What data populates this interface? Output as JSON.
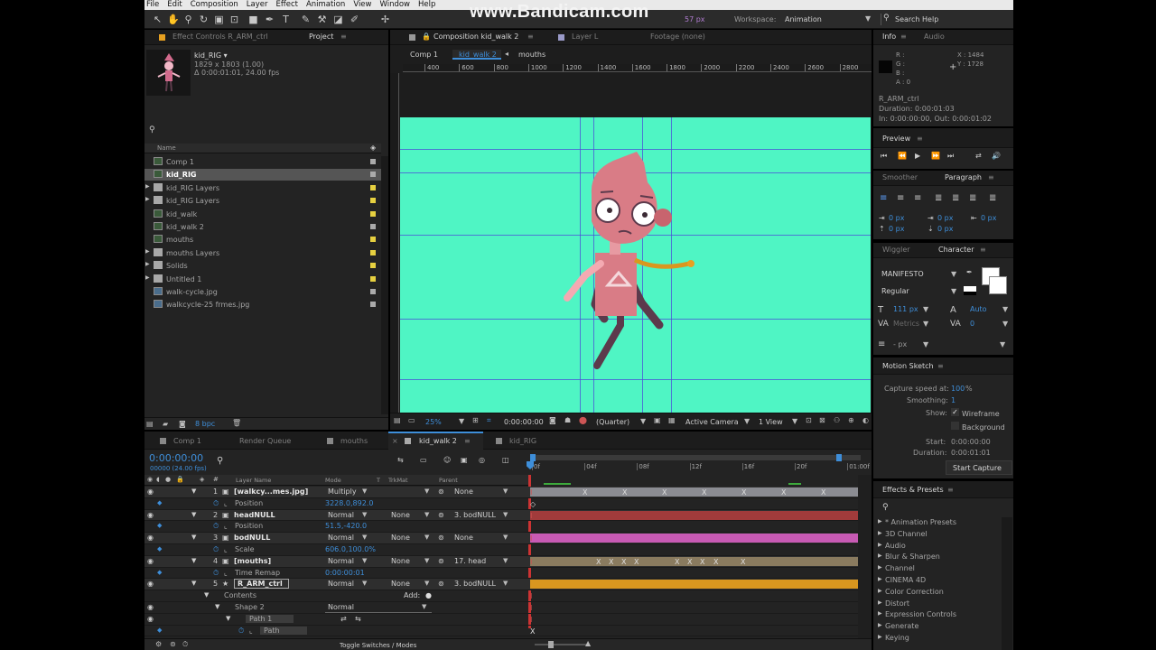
{
  "menu": [
    "File",
    "Edit",
    "Composition",
    "Layer",
    "Effect",
    "Animation",
    "View",
    "Window",
    "Help"
  ],
  "watermark": "www.Bandicam.com",
  "toolbar": {
    "px_field": "57 px",
    "workspace_label": "Workspace:",
    "workspace_value": "Animation",
    "search_placeholder": "Search Help"
  },
  "project": {
    "tabs": [
      "Effect Controls R_ARM_ctrl",
      "Project"
    ],
    "preview": {
      "name": "kid_RIG ▾",
      "size": "1829 x 1803 (1.00)",
      "duration": "Δ 0:00:01:01, 24.00 fps"
    },
    "search_icon": "magnifier-icon",
    "col_name": "Name",
    "items": [
      {
        "name": "Comp 1",
        "type": "comp",
        "twirl": "",
        "label_color": "#aaaaaa"
      },
      {
        "name": "kid_RIG",
        "type": "comp",
        "twirl": "",
        "label_color": "#aaaaaa"
      },
      {
        "name": "kid_RIG Layers",
        "type": "folder",
        "twirl": "▶",
        "label_color": "#e6d040"
      },
      {
        "name": "kid_RIG Layers",
        "type": "folder",
        "twirl": "▶",
        "label_color": "#e6d040"
      },
      {
        "name": "kid_walk",
        "type": "comp",
        "twirl": "",
        "label_color": "#e6d040"
      },
      {
        "name": "kid_walk 2",
        "type": "comp",
        "twirl": "",
        "label_color": "#aaaaaa"
      },
      {
        "name": "mouths",
        "type": "comp",
        "twirl": "",
        "label_color": "#e6d040"
      },
      {
        "name": "mouths Layers",
        "type": "folder",
        "twirl": "▶",
        "label_color": "#e6d040"
      },
      {
        "name": "Solids",
        "type": "folder",
        "twirl": "▶",
        "label_color": "#e6d040"
      },
      {
        "name": "Untitled 1",
        "type": "folder",
        "twirl": "▶",
        "label_color": "#e6d040"
      },
      {
        "name": "walk-cycle.jpg",
        "type": "image",
        "twirl": "",
        "label_color": "#aaaaaa"
      },
      {
        "name": "walkcycle-25 frmes.jpg",
        "type": "image",
        "twirl": "",
        "label_color": "#aaaaaa"
      }
    ],
    "footer_bpc": "8 bpc"
  },
  "comp": {
    "tabs": [
      "Composition kid_walk 2",
      "Layer L",
      "Footage (none)"
    ],
    "breadcrumbs": [
      "Comp 1",
      "kid_walk 2",
      "mouths"
    ],
    "ruler": [
      "400",
      "600",
      "800",
      "1000",
      "1200",
      "1400",
      "1600",
      "1800",
      "2000",
      "2200",
      "2400",
      "2600",
      "2800"
    ],
    "bg_color": "#4ff5c4",
    "footer": {
      "zoom": "25%",
      "timecode": "0:00:00:00",
      "resolution": "(Quarter)",
      "camera": "Active Camera",
      "views": "1 View"
    }
  },
  "info": {
    "tabs": [
      "Info",
      "Audio"
    ],
    "rgb": [
      "R :",
      "G :",
      "B :",
      "A : 0"
    ],
    "xy": [
      "X : 1484",
      "Y : 1728"
    ],
    "layer": "R_ARM_ctrl",
    "duration": "Duration: 0:00:01:03",
    "inout": "In: 0:00:00:00, Out: 0:00:01:02"
  },
  "preview": {
    "title": "Preview"
  },
  "smoother": {
    "tabs": [
      "Smoother",
      "Paragraph"
    ],
    "values": [
      "0 px",
      "0 px",
      "0 px",
      "0 px",
      "0 px"
    ]
  },
  "character": {
    "tabs": [
      "Wiggler",
      "Character"
    ],
    "font": "MANIFESTO",
    "style": "Regular",
    "size": "111 px",
    "leading": "Auto",
    "kerning": "Metrics",
    "tracking": "0",
    "stroke": "- px"
  },
  "motion_sketch": {
    "title": "Motion Sketch",
    "speed_label": "Capture speed at:",
    "speed": "100",
    "speed_unit": "%",
    "smoothing_label": "Smoothing:",
    "smoothing": "1",
    "show_label": "Show:",
    "wireframe": "Wireframe",
    "background": "Background",
    "start_label": "Start:",
    "start": "0:00:00:00",
    "duration_label": "Duration:",
    "duration": "0:00:01:01",
    "capture_button": "Start Capture"
  },
  "effects": {
    "title": "Effects & Presets",
    "items": [
      "* Animation Presets",
      "3D Channel",
      "Audio",
      "Blur & Sharpen",
      "Channel",
      "CINEMA 4D",
      "Color Correction",
      "Distort",
      "Expression Controls",
      "Generate",
      "Keying"
    ]
  },
  "timeline": {
    "tabs": [
      {
        "name": "Comp 1",
        "color": "#888888"
      },
      {
        "name": "Render Queue",
        "color": ""
      },
      {
        "name": "mouths",
        "color": "#888888"
      },
      {
        "name": "kid_walk 2",
        "color": "#aaaaaa"
      },
      {
        "name": "kid_RIG",
        "color": "#888888"
      }
    ],
    "timecode": "0:00:00:00",
    "fps": "00000 (24.00 fps)",
    "headers": {
      "layer_name": "Layer Name",
      "mode": "Mode",
      "t": "T",
      "trkmat": "TrkMat",
      "parent": "Parent"
    },
    "ruler": [
      "0f",
      "04f",
      "08f",
      "12f",
      "16f",
      "20f",
      "01:00f"
    ],
    "rows": [
      {
        "kind": "layer",
        "num": "1",
        "name": "[walkcy...mes.jpg]",
        "label": "#a0a0c8",
        "mode": "Multiply",
        "trk": "",
        "parent": "None",
        "bar": "#8b8c92"
      },
      {
        "kind": "prop",
        "name": "Position",
        "value": "3228.0,892.0",
        "bar": ""
      },
      {
        "kind": "layer",
        "num": "2",
        "name": "headNULL",
        "label": "#c8443c",
        "mode": "Normal",
        "trk": "None",
        "parent": "3. bodNULL",
        "bar": "#a13b3b"
      },
      {
        "kind": "prop",
        "name": "Position",
        "value": "51.5,-420.0",
        "bar": ""
      },
      {
        "kind": "layer",
        "num": "3",
        "name": "bodNULL",
        "label": "#d45fc0",
        "mode": "Normal",
        "trk": "None",
        "parent": "None",
        "bar": "#c85ab4"
      },
      {
        "kind": "prop",
        "name": "Scale",
        "value": "606.0,100.0%",
        "bar": ""
      },
      {
        "kind": "layer",
        "num": "4",
        "name": "[mouths]",
        "label": "#b89a64",
        "mode": "Normal",
        "trk": "None",
        "parent": "17. head",
        "bar": "#8a7b5f"
      },
      {
        "kind": "prop",
        "name": "Time Remap",
        "value": "0:00:00:01",
        "bar": ""
      },
      {
        "kind": "layer",
        "num": "5",
        "name": "R_ARM_ctrl",
        "label": "#e8a020",
        "mode": "Normal",
        "trk": "None",
        "parent": "3. bodNULL",
        "bar": "#d9971f"
      },
      {
        "kind": "group",
        "name": "Contents",
        "value": "Add:",
        "bar": ""
      },
      {
        "kind": "group2",
        "name": "Shape 2",
        "value": "Normal",
        "bar": ""
      },
      {
        "kind": "group3",
        "name": "Path 1",
        "value": "",
        "bar": ""
      },
      {
        "kind": "prop2",
        "name": "Path",
        "value": "",
        "bar": ""
      }
    ],
    "footer": "Toggle Switches / Modes"
  }
}
